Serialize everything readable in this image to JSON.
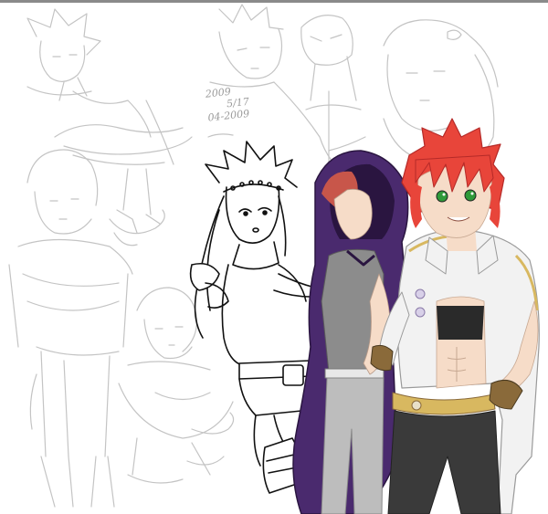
{
  "artwork": {
    "handwritten_note": {
      "line1": "2009",
      "line2": "5/17",
      "line3": "04-2009"
    },
    "colors": {
      "background": "#ffffff",
      "sketch_line": "#c4c4c4",
      "ink_line": "#111111",
      "red_hair": "#e8453a",
      "red_hair_shadow": "#b52a28",
      "cloak_purple": "#4a2a6e",
      "cloak_purple_dark": "#2a1540",
      "shirt_gray": "#8c8c8c",
      "skin": "#f6dcc8",
      "white_coat": "#f2f2f2",
      "gold_trim": "#d8b860",
      "pants_dark": "#3a3a3a",
      "belt_brown": "#8a6a3a",
      "eyes_green": "#2f9a3a"
    }
  }
}
